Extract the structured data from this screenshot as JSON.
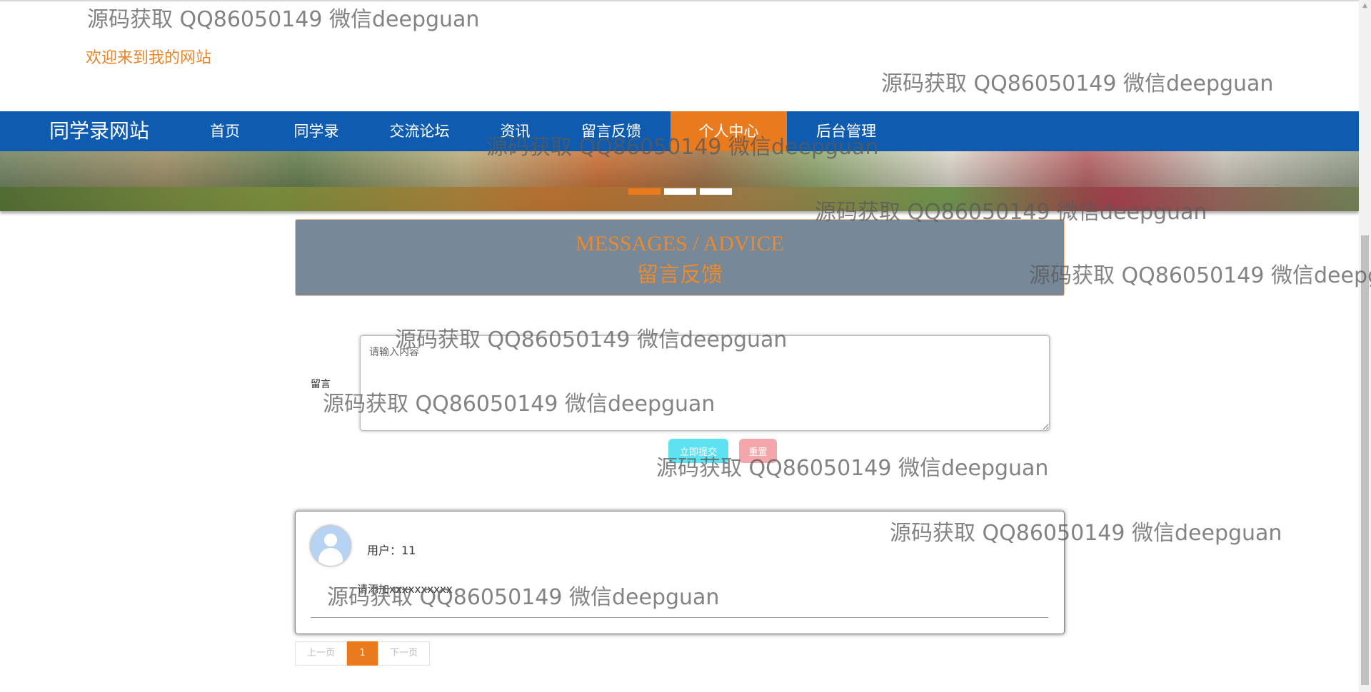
{
  "header": {
    "welcome": "欢迎来到我的网站"
  },
  "nav": {
    "brand": "同学录网站",
    "items": [
      {
        "label": "首页"
      },
      {
        "label": "同学录"
      },
      {
        "label": "交流论坛"
      },
      {
        "label": "资讯"
      },
      {
        "label": "留言反馈"
      },
      {
        "label": "个人中心",
        "active": true
      },
      {
        "label": "后台管理"
      }
    ]
  },
  "banner": {
    "slides": 3,
    "active_slide": 1
  },
  "section": {
    "title_en": "MESSAGES / ADVICE",
    "title_cn": "留言反馈"
  },
  "form": {
    "label": "留言",
    "placeholder": "请输入内容",
    "submit_label": "立即提交",
    "reset_label": "重置"
  },
  "messages": [
    {
      "user": "用户：11",
      "content": "请添加xxxxxxxxxx"
    }
  ],
  "pagination": {
    "prev": "上一页",
    "current": "1",
    "next": "下一页"
  },
  "watermark": "源码获取 QQ86050149 微信deepguan",
  "colors": {
    "nav_bg": "#0f5bb0",
    "accent": "#ea7a1e",
    "header_box": "#778899",
    "submit": "#5ee1f0",
    "reset": "#f4a7ab"
  }
}
